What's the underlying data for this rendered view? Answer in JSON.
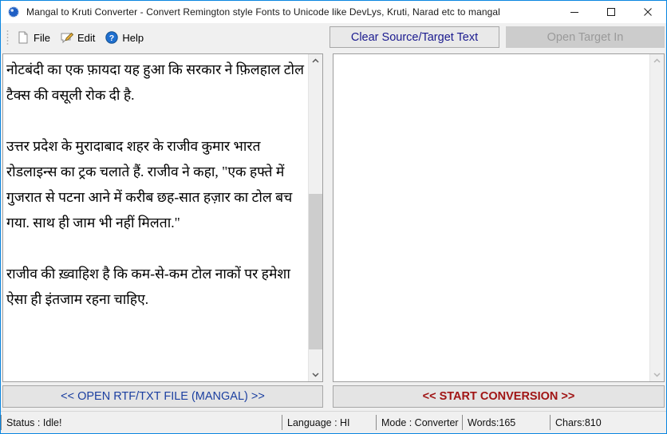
{
  "window": {
    "title": "Mangal to Kruti Converter - Convert Remington style Fonts to Unicode like DevLys, Kruti, Narad etc to mangal",
    "app_icon": "app-circle-icon",
    "accent_border": "#0a86e0",
    "controls": {
      "minimize": "minimize-icon",
      "maximize": "maximize-icon",
      "close": "close-icon"
    }
  },
  "toolbar": {
    "grip": "drag-grip",
    "menu": [
      {
        "label": "File",
        "icon": "document-icon"
      },
      {
        "label": "Edit",
        "icon": "pencil-note-icon"
      },
      {
        "label": "Help",
        "icon": "question-mark-icon"
      }
    ],
    "clear_button": {
      "label": "Clear Source/Target Text",
      "enabled": true,
      "color": "#1b1b8f"
    },
    "open_target_button": {
      "label": "Open Target In",
      "enabled": false,
      "color": "#9a9a9a"
    }
  },
  "source_panel": {
    "name": "source-text-area",
    "paragraphs": [
      [
        "नोटबंदी का एक फ़ायदा यह हुआ कि सरकार ने फ़िलहाल टोल",
        "टैक्स की वसूली रोक दी है."
      ],
      [
        "उत्तर प्रदेश के मुरादाबाद शहर के राजीव कुमार भारत",
        "रोडलाइन्स का ट्रक चलाते हैं. राजीव ने कहा, \"एक हफ्ते में",
        "गुजरात से पटना आने में करीब छह-सात हज़ार का टोल बच",
        "गया. साथ ही जाम भी नहीं मिलता.\""
      ],
      [
        "राजीव की ख़्वाहिश है कि कम-से-कम टोल नाकों पर हमेशा",
        "ऐसा ही इंतजाम रहना चाहिए."
      ]
    ],
    "scrollbar": {
      "up_arrow": "chevron-up-icon",
      "down_arrow": "chevron-down-icon",
      "thumb_top_pct": 42,
      "thumb_height_pct": 52
    }
  },
  "target_panel": {
    "name": "target-text-area",
    "text": "",
    "scrollbar": {
      "up_arrow": "chevron-up-icon",
      "down_arrow": "chevron-down-icon",
      "thumb_top_pct": 0,
      "thumb_height_pct": 0
    }
  },
  "bottom": {
    "open_file_button": {
      "label": "<< OPEN RTF/TXT FILE (MANGAL) >>",
      "color": "#1b3fa0"
    },
    "start_conversion_button": {
      "label": "<< START CONVERSION >>",
      "color": "#a01414"
    }
  },
  "statusbar": {
    "status": "Status :  Idle!",
    "language": "Language : HI",
    "mode": "Mode : Converter",
    "words": "Words:165",
    "chars": "Chars:810"
  }
}
